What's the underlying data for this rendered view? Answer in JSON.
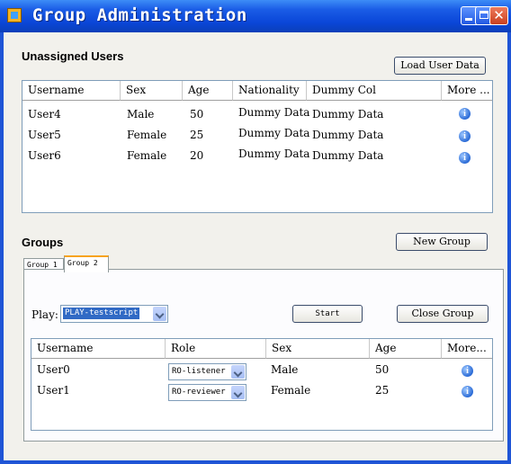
{
  "window": {
    "title": "Group Administration",
    "close_glyph": "✕"
  },
  "unassigned": {
    "label": "Unassigned Users",
    "load_button": "Load User Data",
    "columns": [
      "Username",
      "Sex",
      "Age",
      "Nationality",
      "Dummy Col",
      "More ..."
    ],
    "rows": [
      [
        "User4",
        "Male",
        "50",
        "Dummy Data",
        "Dummy Data"
      ],
      [
        "User5",
        "Female",
        "25",
        "Dummy Data",
        "Dummy Data"
      ],
      [
        "User6",
        "Female",
        "20",
        "Dummy Data",
        "Dummy Data"
      ]
    ]
  },
  "groups": {
    "label": "Groups",
    "new_button": "New Group",
    "tabs": [
      "Group 1",
      "Group 2"
    ],
    "active_tab": "Group 2",
    "play_label": "Play:",
    "play_value": "PLAY-testscript",
    "start_button": "Start",
    "close_button": "Close Group",
    "columns": [
      "Username",
      "Role",
      "Sex",
      "Age",
      "More..."
    ],
    "rows": [
      {
        "username": "User0",
        "role": "RO-listener",
        "sex": "Male",
        "age": "50"
      },
      {
        "username": "User1",
        "role": "RO-reviewer",
        "sex": "Female",
        "age": "25"
      }
    ]
  },
  "icons": {
    "app": "app-icon",
    "info": "info-icon",
    "dropdown": "chevron-down-icon"
  },
  "colors": {
    "titlebar": "#0a46d8",
    "tab_highlight": "#f7a31c",
    "selection": "#316ac5"
  }
}
